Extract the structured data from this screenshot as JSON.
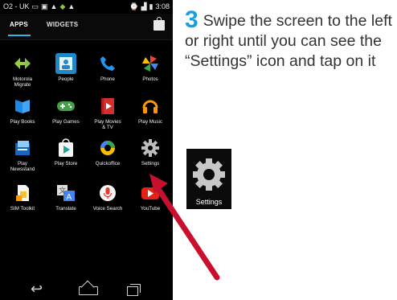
{
  "status_bar": {
    "carrier": "O2 - UK",
    "time": "3:08"
  },
  "tabs": {
    "apps_label": "APPS",
    "widgets_label": "WIDGETS"
  },
  "apps": [
    {
      "label": "Motorola\nMigrate",
      "icon": "motorola-migrate-icon"
    },
    {
      "label": "People",
      "icon": "people-icon"
    },
    {
      "label": "Phone",
      "icon": "phone-icon"
    },
    {
      "label": "Photos",
      "icon": "photos-icon"
    },
    {
      "label": "Play Books",
      "icon": "play-books-icon"
    },
    {
      "label": "Play Games",
      "icon": "play-games-icon"
    },
    {
      "label": "Play Movies\n& TV",
      "icon": "play-movies-icon"
    },
    {
      "label": "Play Music",
      "icon": "play-music-icon"
    },
    {
      "label": "Play\nNewsstand",
      "icon": "play-newsstand-icon"
    },
    {
      "label": "Play Store",
      "icon": "play-store-icon"
    },
    {
      "label": "Quickoffice",
      "icon": "quickoffice-icon"
    },
    {
      "label": "Settings",
      "icon": "settings-icon"
    },
    {
      "label": "SIM Toolkit",
      "icon": "sim-toolkit-icon"
    },
    {
      "label": "Translate",
      "icon": "translate-icon"
    },
    {
      "label": "Voice Search",
      "icon": "voice-search-icon"
    },
    {
      "label": "YouTube",
      "icon": "youtube-icon"
    }
  ],
  "instruction": {
    "step_number": "3",
    "text": "Swipe the screen to the left or right until you can see the “Settings” icon and tap on it"
  },
  "settings_tile": {
    "label": "Settings"
  },
  "colors": {
    "step_accent": "#1aa0d8",
    "arrow": "#c8102e",
    "tab_underline": "#33b5e5"
  }
}
